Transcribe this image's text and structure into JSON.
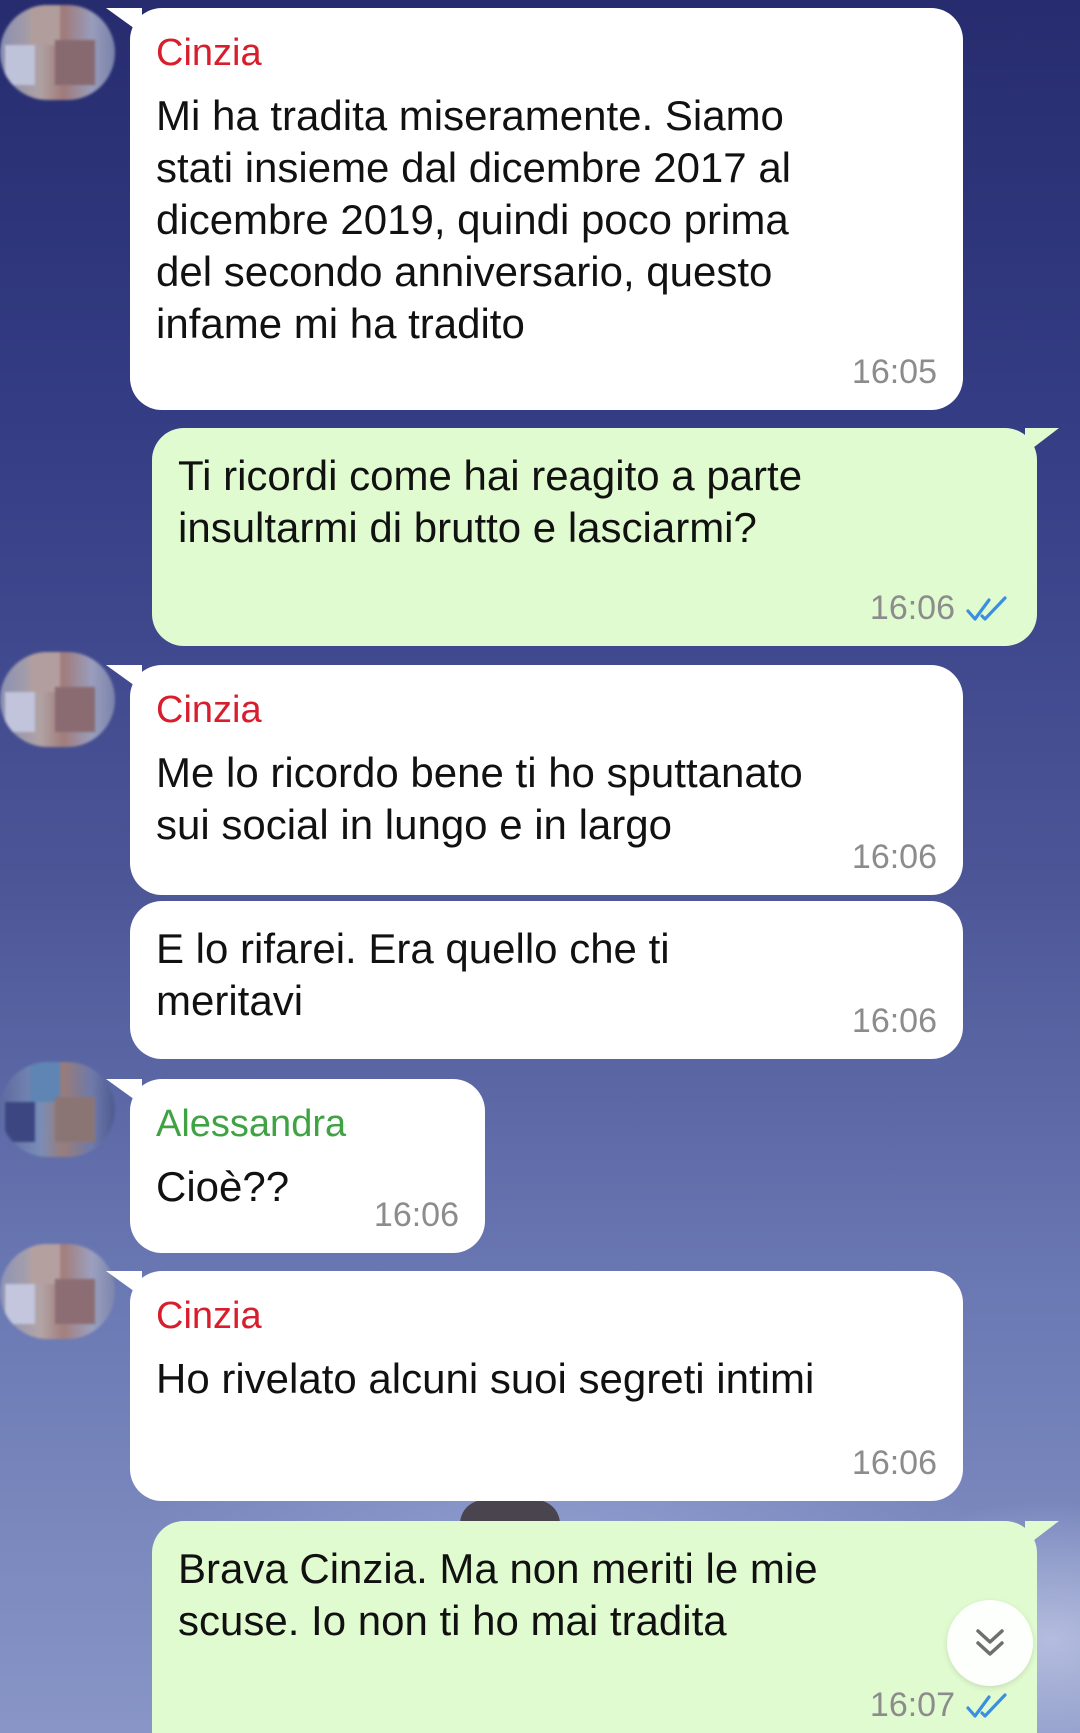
{
  "colors": {
    "incoming_bubble": "#ffffff",
    "outgoing_bubble": "#e1fbd0",
    "sender_red": "#d81e2c",
    "sender_green": "#3fa344",
    "read_ticks": "#3b8fe0",
    "timestamp": "#8c8c8c"
  },
  "messages": [
    {
      "direction": "in",
      "sender": "Cinzia",
      "text": "Mi ha tradita miseramente. Siamo\nstati insieme dal dicembre 2017 al\ndicembre 2019, quindi poco prima\ndel secondo anniversario, questo\ninfame mi ha tradito",
      "time": "16:05"
    },
    {
      "direction": "out",
      "text": "Ti ricordi come hai reagito a parte\ninsultarmi di brutto e lasciarmi?",
      "time": "16:06",
      "status_icon": "double-check-icon"
    },
    {
      "direction": "in",
      "sender": "Cinzia",
      "text": "Me lo ricordo bene ti ho sputtanato\nsui social in lungo e in largo",
      "time": "16:06"
    },
    {
      "direction": "in",
      "text": "E lo rifarei. Era quello che ti\nmeritavi",
      "time": "16:06"
    },
    {
      "direction": "in",
      "sender": "Alessandra",
      "text": "Cioè??",
      "time": "16:06"
    },
    {
      "direction": "in",
      "sender": "Cinzia",
      "text": "Ho rivelato alcuni suoi segreti intimi",
      "time": "16:06"
    },
    {
      "direction": "out",
      "text": "Brava Cinzia. Ma non meriti le mie\nscuse. Io non ti ho mai tradita",
      "time": "16:07",
      "status_icon": "double-check-icon"
    }
  ],
  "scroll_button_icon": "double-chevron-down-icon"
}
